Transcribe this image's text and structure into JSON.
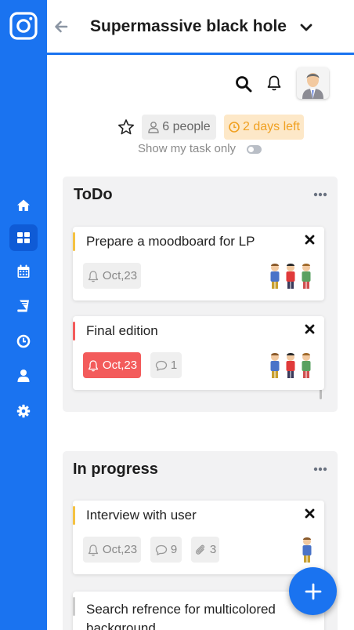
{
  "header": {
    "title": "Supermassive black hole"
  },
  "project": {
    "people_label": "6 people",
    "days_left_label": "2 days left",
    "show_my_tasks_label": "Show my task only"
  },
  "sidebar": {
    "items": [
      {
        "icon": "home-icon"
      },
      {
        "icon": "dashboard-icon",
        "active": true
      },
      {
        "icon": "calendar-icon"
      },
      {
        "icon": "book-icon"
      },
      {
        "icon": "clock-icon"
      },
      {
        "icon": "user-icon"
      },
      {
        "icon": "gear-icon"
      }
    ]
  },
  "columns": [
    {
      "title": "ToDo",
      "cards": [
        {
          "title": "Prepare a moodboard for LP",
          "bar_color": "#f5c242",
          "date": "Oct,23",
          "date_overdue": false
        },
        {
          "title": "Final edition",
          "bar_color": "#f35b5b",
          "date": "Oct,23",
          "date_overdue": true,
          "comments": "1"
        }
      ]
    },
    {
      "title": "In progress",
      "cards": [
        {
          "title": "Interview with user",
          "bar_color": "#f5c242",
          "date": "Oct,23",
          "comments": "9",
          "attachments": "3"
        },
        {
          "title": "Search refrence for multicolored background",
          "bar_color": "#cccccc"
        }
      ]
    }
  ],
  "colors": {
    "accent": "#1a73f0",
    "overdue": "#f35b5b",
    "warning": "#f0a020"
  }
}
